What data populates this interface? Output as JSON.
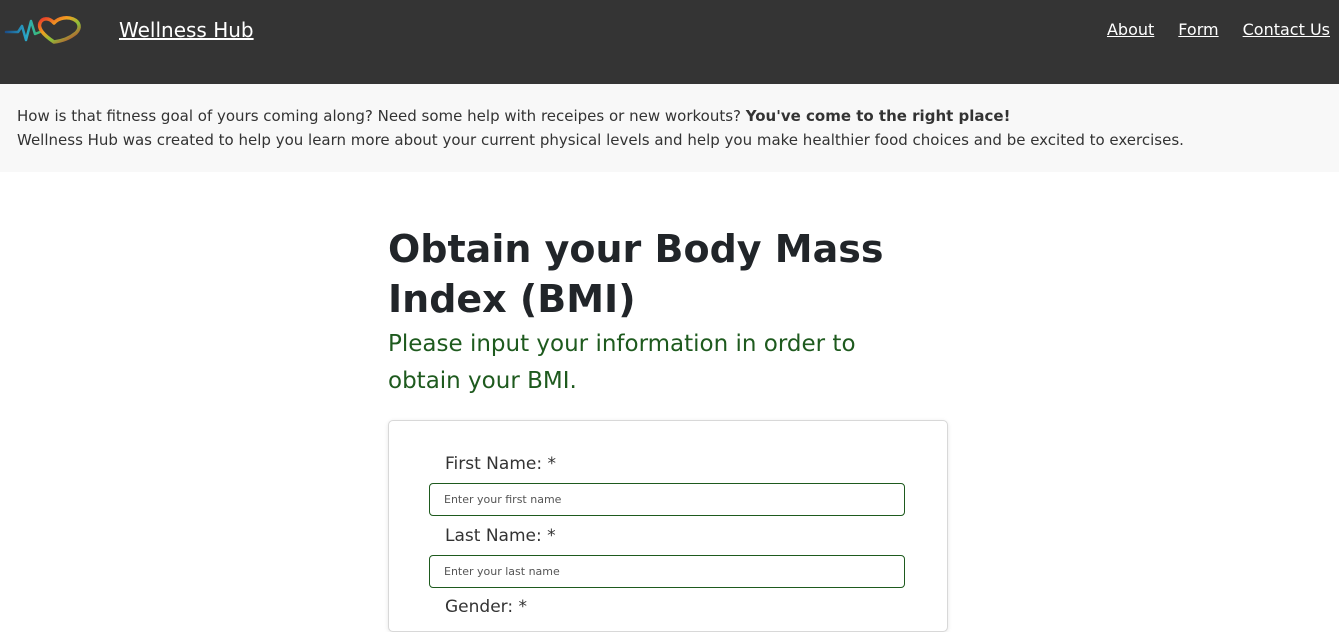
{
  "header": {
    "brand_name": "Wellness Hub",
    "logo_icon": "heartbeat-heart-logo",
    "nav": [
      {
        "label": "About"
      },
      {
        "label": "Form"
      },
      {
        "label": "Contact Us"
      }
    ]
  },
  "intro": {
    "line1_text": "How is that fitness goal of yours coming along? Need some help with receipes or new workouts?",
    "line1_bold": "You've come to the right place!",
    "line2_text": "Wellness Hub was created to help you learn more about your current physical levels and help you make healthier food choices and be excited to exercises."
  },
  "main": {
    "title": "Obtain your Body Mass Index (BMI)",
    "subtitle": "Please input your information in order to obtain your BMI."
  },
  "form": {
    "first_name": {
      "label": "First Name: *",
      "placeholder": "Enter your first name",
      "value": ""
    },
    "last_name": {
      "label": "Last Name: *",
      "placeholder": "Enter your last name",
      "value": ""
    },
    "gender": {
      "label": "Gender: *"
    }
  },
  "colors": {
    "navbar_bg": "#343434",
    "intro_bg": "#f8f8f8",
    "subtitle_green": "#1e5a1e",
    "input_border": "#1e5a1e"
  }
}
